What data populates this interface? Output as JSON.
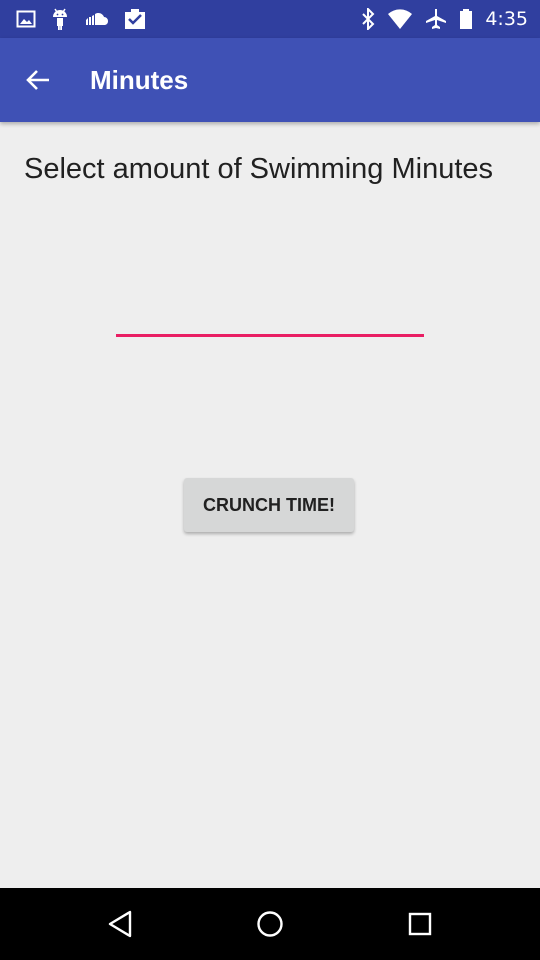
{
  "status_bar": {
    "time": "4:35",
    "left_icons": [
      "image-icon",
      "android-icon",
      "cloud-icon",
      "clipboard-check-icon"
    ],
    "right_icons": [
      "bluetooth-icon",
      "wifi-icon",
      "airplane-icon",
      "battery-icon"
    ]
  },
  "app_bar": {
    "title": "Minutes",
    "back_icon": "arrow-back-icon",
    "background": "#3f51b5"
  },
  "content": {
    "prompt": "Select amount of Swimming Minutes",
    "input_value": "",
    "input_accent": "#e91e63",
    "button_label": "CRUNCH TIME!"
  },
  "nav_bar": {
    "buttons": [
      "back-triangle-icon",
      "home-circle-icon",
      "recents-square-icon"
    ]
  }
}
